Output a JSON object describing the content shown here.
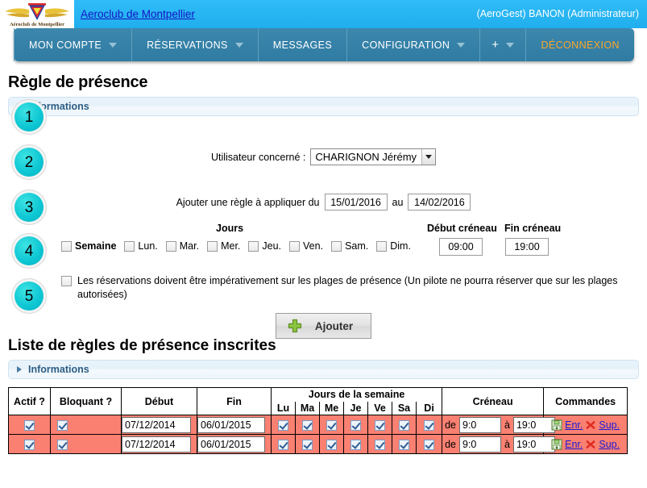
{
  "topbar": {
    "logo_alt": "Aeroclub de Montpellier",
    "site_link": "Aeroclub de Montpellier",
    "user_info": "(AeroGest) BANON (Administrateur)"
  },
  "nav": {
    "items": [
      {
        "label": "MON COMPTE",
        "has_caret": true
      },
      {
        "label": "RÉSERVATIONS",
        "has_caret": true
      },
      {
        "label": "MESSAGES",
        "has_caret": false
      },
      {
        "label": "CONFIGURATION",
        "has_caret": true
      },
      {
        "label": "+",
        "has_caret": true
      }
    ],
    "logout_label": "DÉCONNEXION"
  },
  "page": {
    "title": "Règle de présence",
    "info_panel_label": "Informations",
    "list_title": "Liste de règles de présence inscrites",
    "list_info_panel_label": "Informations"
  },
  "steps": [
    {
      "number": "1"
    },
    {
      "number": "2"
    },
    {
      "number": "3"
    },
    {
      "number": "4"
    },
    {
      "number": "5"
    }
  ],
  "form": {
    "user_label": "Utilisateur concerné :",
    "user_selected": "CHARIGNON Jérémy",
    "rule_label_prefix": "Ajouter une règle à appliquer du",
    "date_from": "15/01/2016",
    "rule_label_mid": "au",
    "date_to": "14/02/2016",
    "days_header": "Jours",
    "start_slot_header": "Début créneau",
    "end_slot_header": "Fin créneau",
    "days": [
      {
        "label": "Semaine",
        "checked": false,
        "bold": true
      },
      {
        "label": "Lun.",
        "checked": false,
        "bold": false
      },
      {
        "label": "Mar.",
        "checked": false,
        "bold": false
      },
      {
        "label": "Mer.",
        "checked": false,
        "bold": false
      },
      {
        "label": "Jeu.",
        "checked": false,
        "bold": false
      },
      {
        "label": "Ven.",
        "checked": false,
        "bold": false
      },
      {
        "label": "Sam.",
        "checked": false,
        "bold": false
      },
      {
        "label": "Dim.",
        "checked": false,
        "bold": false
      }
    ],
    "start_time": "09:00",
    "end_time": "19:00",
    "obligatory_text": "Les réservations doivent être impérativement sur les plages de présence (Un pilote ne pourra réserver que sur les plages autorisées)",
    "obligatory_checked": false,
    "add_button_label": "Ajouter"
  },
  "table": {
    "headers": {
      "actif": "Actif ?",
      "bloquant": "Bloquant ?",
      "debut": "Début",
      "fin": "Fin",
      "jours": "Jours de la semaine",
      "creneau": "Créneau",
      "commandes": "Commandes"
    },
    "day_cols": [
      "Lu",
      "Ma",
      "Me",
      "Je",
      "Ve",
      "Sa",
      "Di"
    ],
    "creneau_prefix": "de",
    "creneau_mid": "à",
    "save_label": "Enr.",
    "delete_label": "Sup.",
    "row_color": "#fa8072",
    "rows": [
      {
        "actif": true,
        "bloquant": true,
        "debut": "07/12/2014",
        "fin": "06/01/2015",
        "days": [
          true,
          true,
          true,
          true,
          true,
          true,
          true
        ],
        "start": "9:0",
        "end": "19:0"
      },
      {
        "actif": true,
        "bloquant": true,
        "debut": "07/12/2014",
        "fin": "06/01/2015",
        "days": [
          true,
          true,
          true,
          true,
          true,
          true,
          true
        ],
        "start": "9:0",
        "end": "19:0"
      }
    ]
  },
  "colors": {
    "topbar_blue": "#29b6f6",
    "nav_blue": "#3580a8",
    "logout_orange": "#ffa726",
    "step_teal": "#0fc8d4",
    "row_salmon": "#fa8072",
    "link_blue": "#1515c4"
  }
}
